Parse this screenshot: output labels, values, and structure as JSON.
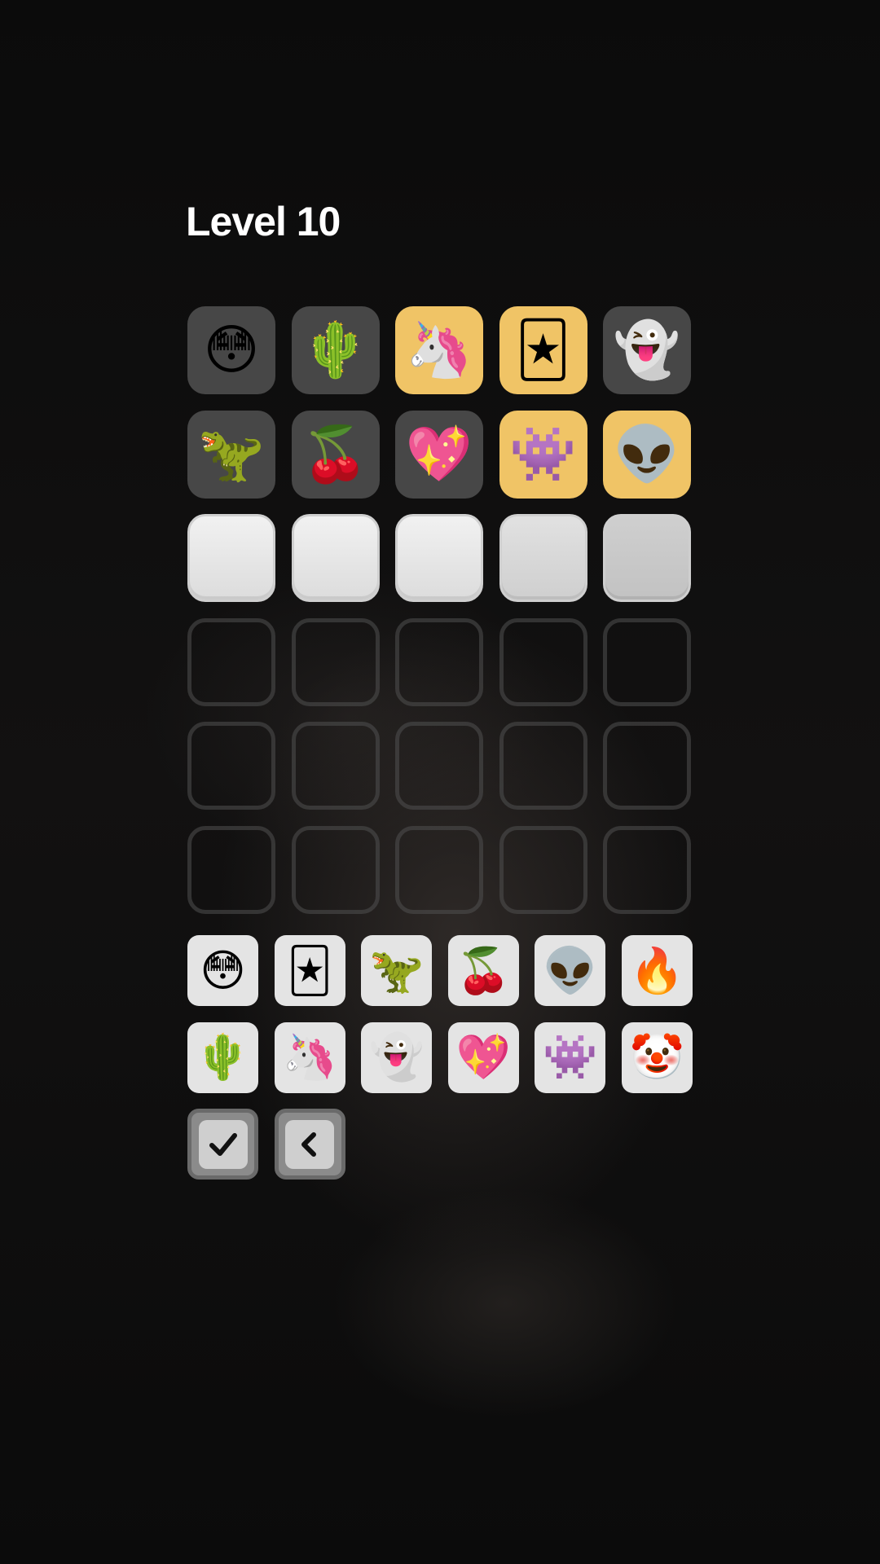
{
  "level": {
    "title": "Level 10"
  },
  "board": {
    "rows": [
      {
        "cells": [
          {
            "emoji": "😳",
            "state": "gray"
          },
          {
            "emoji": "🌵",
            "state": "gray"
          },
          {
            "emoji": "🦄",
            "state": "yellow"
          },
          {
            "emoji": "🃏",
            "state": "yellow"
          },
          {
            "emoji": "👻",
            "state": "gray"
          }
        ]
      },
      {
        "cells": [
          {
            "emoji": "🦖",
            "state": "gray"
          },
          {
            "emoji": "🍒",
            "state": "gray"
          },
          {
            "emoji": "💖",
            "state": "gray"
          },
          {
            "emoji": "👾",
            "state": "yellow"
          },
          {
            "emoji": "👽",
            "state": "yellow"
          }
        ]
      },
      {
        "cells": [
          {
            "emoji": "",
            "state": "current"
          },
          {
            "emoji": "",
            "state": "current"
          },
          {
            "emoji": "",
            "state": "current"
          },
          {
            "emoji": "",
            "state": "current"
          },
          {
            "emoji": "",
            "state": "current"
          }
        ]
      },
      {
        "cells": [
          {
            "emoji": "",
            "state": "empty"
          },
          {
            "emoji": "",
            "state": "empty"
          },
          {
            "emoji": "",
            "state": "empty"
          },
          {
            "emoji": "",
            "state": "empty"
          },
          {
            "emoji": "",
            "state": "empty"
          }
        ]
      },
      {
        "cells": [
          {
            "emoji": "",
            "state": "empty"
          },
          {
            "emoji": "",
            "state": "empty"
          },
          {
            "emoji": "",
            "state": "empty"
          },
          {
            "emoji": "",
            "state": "empty"
          },
          {
            "emoji": "",
            "state": "empty"
          }
        ]
      },
      {
        "cells": [
          {
            "emoji": "",
            "state": "empty"
          },
          {
            "emoji": "",
            "state": "empty"
          },
          {
            "emoji": "",
            "state": "empty"
          },
          {
            "emoji": "",
            "state": "empty"
          },
          {
            "emoji": "",
            "state": "empty"
          }
        ]
      }
    ]
  },
  "keyboard": {
    "row1": [
      "😳",
      "🃏",
      "🦖",
      "🍒",
      "👽",
      "🔥"
    ],
    "row2": [
      "🌵",
      "🦄",
      "👻",
      "💖",
      "👾",
      "🤡"
    ],
    "submit_icon": "checkmark-icon",
    "backspace_icon": "chevron-left-icon"
  },
  "colors": {
    "correct": "#f0c466",
    "absent": "#474747",
    "current": "#e8e8e8",
    "key": "#e4e4e4"
  }
}
